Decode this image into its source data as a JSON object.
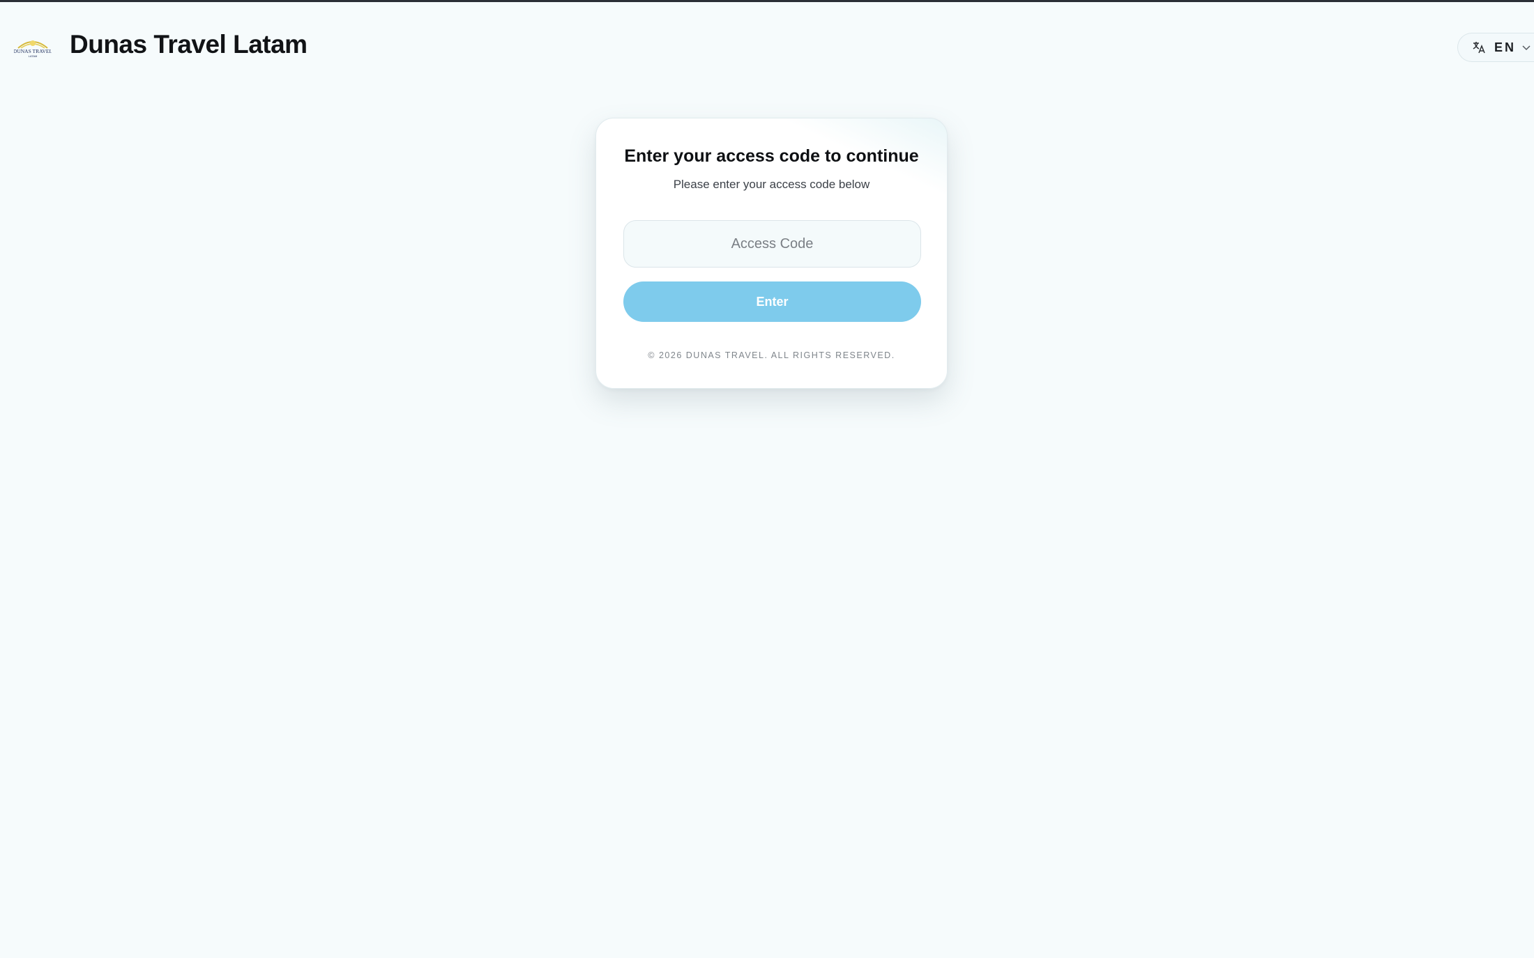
{
  "header": {
    "brand_title": "Dunas Travel Latam",
    "logo_text": "DUNAS TRAVEL",
    "logo_subtext": "LATAM"
  },
  "language": {
    "icon": "translate-icon",
    "code": "EN",
    "dropdown_icon": "chevron-down-icon"
  },
  "card": {
    "title": "Enter your access code to continue",
    "subtitle": "Please enter your access code below",
    "input_placeholder": "Access Code",
    "input_value": "",
    "enter_label": "Enter",
    "copyright": "© 2026 DUNAS TRAVEL. ALL RIGHTS RESERVED."
  },
  "colors": {
    "background": "#f6fbfc",
    "button": "#7ecbec",
    "top_border": "#2b2f36"
  }
}
